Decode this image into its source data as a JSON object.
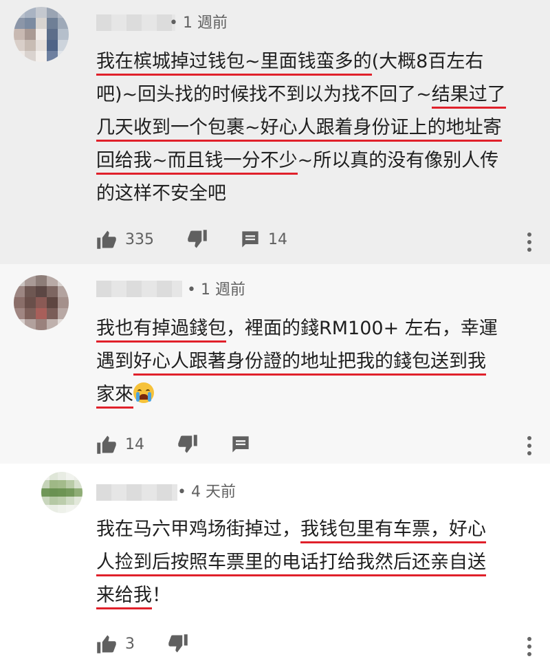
{
  "comments": [
    {
      "time": "• 1 週前",
      "lines": [
        [
          {
            "t": "我在槟城掉过钱包~里面钱蛮多的",
            "u": true
          },
          {
            "t": "(大概8百左右",
            "u": false
          }
        ],
        [
          {
            "t": "吧)~回头找的时候找不到以为找不回了~",
            "u": false
          },
          {
            "t": "结果过了",
            "u": true
          }
        ],
        [
          {
            "t": "几天收到一个包裹~好心人跟着身份证上的地址寄",
            "u": true
          }
        ],
        [
          {
            "t": "回给我~而且钱一分不少",
            "u": true
          },
          {
            "t": "~所以真的没有像别人传",
            "u": false
          }
        ],
        [
          {
            "t": "的这样不安全吧",
            "u": false
          }
        ]
      ],
      "likes": "335",
      "replies": "14"
    },
    {
      "time": "• 1 週前",
      "lines": [
        [
          {
            "t": "我也有掉過錢包",
            "u": true
          },
          {
            "t": "，裡面的錢RM100+ 左右，幸運",
            "u": false
          }
        ],
        [
          {
            "t": "遇到",
            "u": false
          },
          {
            "t": "好心人跟著身份證的地址把我的錢包送到我",
            "u": true
          }
        ],
        [
          {
            "t": "家來",
            "u": true
          },
          {
            "t": "",
            "u": false,
            "emoji": "crying-face"
          }
        ]
      ],
      "likes": "14",
      "replies": ""
    },
    {
      "time": "• 4 天前",
      "lines": [
        [
          {
            "t": "我在马六甲鸡场街掉过，",
            "u": false
          },
          {
            "t": "我钱包里有车票，好心",
            "u": true
          }
        ],
        [
          {
            "t": "人捡到后按照车票里的电话打给我然后还亲自送",
            "u": true
          }
        ],
        [
          {
            "t": "来给我",
            "u": true
          },
          {
            "t": "！",
            "u": false
          }
        ]
      ],
      "likes": "3",
      "replies": ""
    }
  ],
  "colors": {
    "underline": "#e0202a",
    "meta": "#606060"
  }
}
